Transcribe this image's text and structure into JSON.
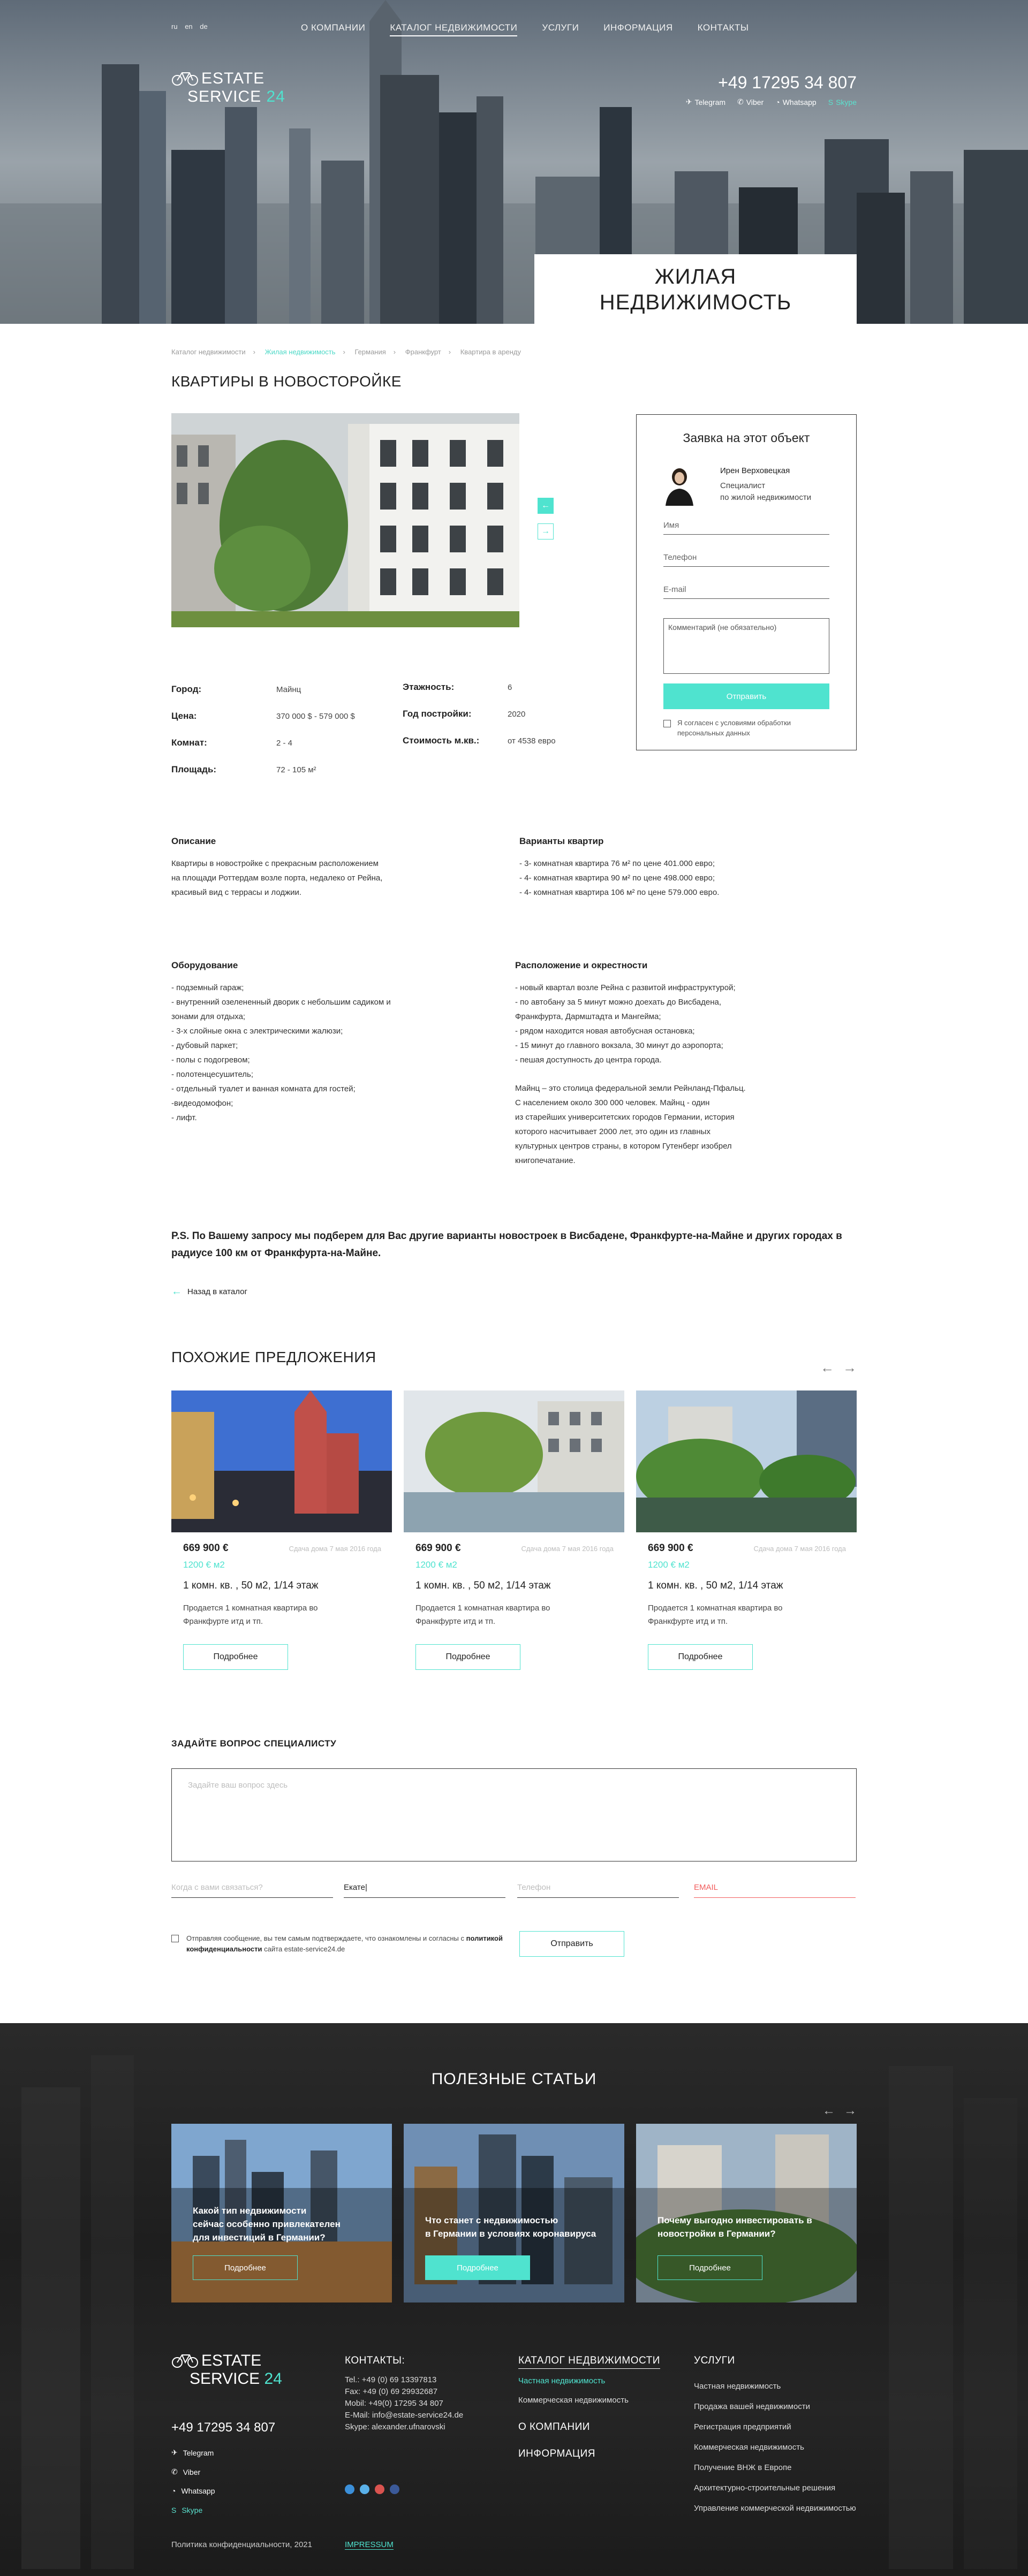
{
  "langs": [
    "ru",
    "en",
    "de"
  ],
  "nav": [
    "О КОМПАНИИ",
    "КАТАЛОГ НЕДВИЖИМОСТИ",
    "УСЛУГИ",
    "ИНФОРМАЦИЯ",
    "КОНТАКТЫ"
  ],
  "brand": {
    "line1": "ESTATE",
    "line2": "SERVICE",
    "num": "24"
  },
  "header": {
    "phone": "+49 17295 34 807",
    "socials": [
      "Telegram",
      "Viber",
      "Whatsapp",
      "Skype"
    ]
  },
  "hero": {
    "line1": "ЖИЛАЯ",
    "line2": "НЕДВИЖИМОСТЬ"
  },
  "breadcrumb": [
    "Каталог недвижимости",
    "Жилая недвижимость",
    "Германия",
    "Франкфурт",
    "Квартира в аренду"
  ],
  "listing_title": "КВАРТИРЫ В НОВОСТОРОЙКЕ",
  "params": {
    "city_label": "Город:",
    "city": "Майнц",
    "price_label": "Цена:",
    "price": "370 000 $ - 579 000 $",
    "rooms_label": "Комнат:",
    "rooms": "2 - 4",
    "area_label": "Площадь:",
    "area": "72 - 105 м²",
    "floors_label": "Этажность:",
    "floors": "6",
    "year_label": "Год постройки:",
    "year": "2020",
    "sqm_label": "Стоимость м.кв.:",
    "sqm": "от 4538 евро"
  },
  "request": {
    "title": "Заявка на этот объект",
    "agent_name": "Ирен Верховецкая",
    "agent_role1": "Специалист",
    "agent_role2": "по жилой недвижимости",
    "name_ph": "Имя",
    "phone_ph": "Телефон",
    "email_ph": "E-mail",
    "comment_ph": "Комментарий (не обязательно)",
    "send": "Отправить",
    "agree": "Я согласен с условиями обработки персональных данных"
  },
  "desc": {
    "title": "Описание",
    "lines": [
      "Квартиры в новостройке с прекрасным расположением",
      "на площади Роттердам возле порта, недалеко от Рейна,",
      "красивый вид с террасы и лоджии."
    ]
  },
  "variants": {
    "title": "Варианты квартир",
    "lines": [
      "- 3- комнатная квартира 76 м² по цене 401.000 евро;",
      "- 4- комнатная квартира 90 м² по цене 498.000 евро;",
      "- 4- комнатная квартира 106 м² по цене 579.000 евро."
    ]
  },
  "equipment": {
    "title": "Оборудование",
    "lines": [
      "- подземный гараж;",
      "- внутренний озелененный дворик с небольшим садиком и",
      "зонами для отдыха;",
      "- 3-х слойные окна с электрическими жалюзи;",
      "- дубовый паркет;",
      "- полы с подогревом;",
      "- полотенцесушитель;",
      "- отдельный туалет и ванная комната для гостей;",
      "-видеодомофон;",
      "- лифт."
    ]
  },
  "location": {
    "title": "Расположение и окрестности",
    "lines": [
      "- новый квартал возле Рейна с развитой инфраструктурой;",
      "- по автобану за 5 минут можно доехать до Висбадена,",
      "Франкфурта, Дармштадта и Мангейма;",
      "- рядом находится новая автобусная остановка;",
      "- 15 минут до главного вокзала, 30 минут до аэропорта;",
      "- пешая доступность до центра города."
    ],
    "para": [
      "Майнц – это столица федеральной земли Рейнланд-Пфальц.",
      "С населением около 300 000 человек. Майнц - один",
      "из старейших университетских городов Германии, история",
      "которого насчитывает 2000 лет, это один из главных",
      "культурных центров страны, в котором Гутенберг изобрел",
      "книгопечатание."
    ]
  },
  "ps": "P.S. По Вашему запросу мы подберем для Вас другие варианты новостроек в Висбадене, Франкфурте-на-Майне и других городах в радиусе 100 км от Франкфурта-на-Майне.",
  "back": "Назад в каталог",
  "similar": {
    "title": "ПОХОЖИЕ ПРЕДЛОЖЕНИЯ",
    "cards": [
      {
        "price": "669 900 €",
        "date": "Сдача дома 7 мая 2016 года",
        "m2": "1200 € м2",
        "rooms": "1 комн. кв. , 50 м2, 1/14 этаж",
        "desc": "Продается 1 комнатная квартира во Франкфурте итд и тп.",
        "btn": "Подробнее"
      },
      {
        "price": "669 900 €",
        "date": "Сдача дома 7 мая 2016 года",
        "m2": "1200 € м2",
        "rooms": "1 комн. кв. , 50 м2, 1/14 этаж",
        "desc": "Продается 1 комнатная квартира во Франкфурте итд и тп.",
        "btn": "Подробнее"
      },
      {
        "price": "669 900 €",
        "date": "Сдача дома 7 мая 2016 года",
        "m2": "1200 € м2",
        "rooms": "1 комн. кв. , 50 м2, 1/14 этаж",
        "desc": "Продается 1 комнатная квартира во Франкфурте итд и тп.",
        "btn": "Подробнее"
      }
    ]
  },
  "ask": {
    "title": "ЗАДАЙТЕ ВОПРОС СПЕЦИАЛИСТУ",
    "area_ph": "Задайте ваш вопрос здесь",
    "when_ph": "Когда с вами связаться?",
    "name_val": "Екате|",
    "phone_ph": "Телефон",
    "email_ph": "EMAIL",
    "agree_pre": "Отправляя сообщение, вы тем самым подтверждаете, что ознакомлены и согласны с",
    "agree_link": "политикой конфиденциальности",
    "agree_post": "сайта estate-service24.de",
    "send": "Отправить"
  },
  "articles": {
    "title": "ПОЛЕЗНЫЕ СТАТЬИ",
    "items": [
      {
        "l1": "Какой тип недвижимости",
        "l2": "сейчас особенно привлекателен",
        "l3": "для инвестиций в Германии?",
        "btn": "Подробнее"
      },
      {
        "l1": "Что станет с недвижимостью",
        "l2": "в Германии в условиях коронавируса",
        "l3": "",
        "btn": "Подробнее"
      },
      {
        "l1": "Почему выгодно инвестировать в",
        "l2": "новостройки в Германии?",
        "l3": "",
        "btn": "Подробнее"
      }
    ]
  },
  "footer": {
    "phone": "+49 17295 34 807",
    "socials": [
      "Telegram",
      "Viber",
      "Whatsapp",
      "Skype"
    ],
    "contacts_title": "КОНТАКТЫ:",
    "contacts": [
      "Tel.: +49 (0) 69 13397813",
      "Fax: +49 (0) 69 29932687",
      "Mobil: +49(0) 17295 34 807",
      "E-Mail: info@estate-service24.de",
      "Skype: alexander.ufnarovski"
    ],
    "catalog_title": "КАТАЛОГ НЕДВИЖИМОСТИ",
    "catalog": [
      "Частная недвижимость",
      "Коммерческая недвижимость"
    ],
    "about": "О КОМПАНИИ",
    "info": "ИНФОРМАЦИЯ",
    "services_title": "УСЛУГИ",
    "services": [
      "Частная недвижимость",
      "Продажа вашей недвижимости",
      "Регистрация предприятий",
      "Коммерческая недвижимость",
      "Получение ВНЖ в Европе",
      "Архитектурно-строительные решения",
      "Управление коммерческой недвижимостью"
    ],
    "copyright": "Политика конфиденциальности, 2021",
    "impressum": "IMPRESSUM"
  },
  "colors": {
    "accent": "#4fe3cf",
    "error": "#f25c5c",
    "dark": "#222222"
  }
}
